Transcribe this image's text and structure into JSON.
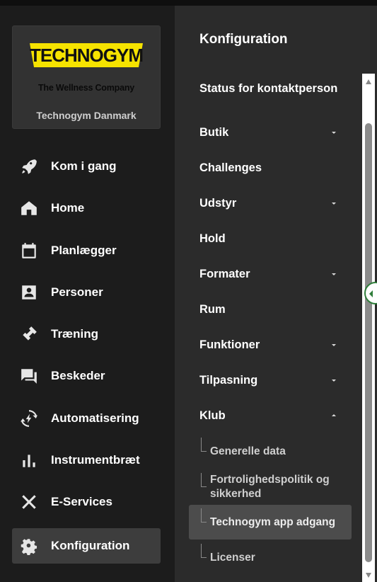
{
  "brand": {
    "logo_text": "TECHNOGYM",
    "tagline": "The Wellness Company",
    "club_name": "Technogym Danmark",
    "logo_color": "#f6e300"
  },
  "nav": [
    {
      "label": "Kom i gang",
      "icon": "rocket-icon"
    },
    {
      "label": "Home",
      "icon": "home-icon"
    },
    {
      "label": "Planlægger",
      "icon": "calendar-icon"
    },
    {
      "label": "Personer",
      "icon": "person-card-icon"
    },
    {
      "label": "Træning",
      "icon": "dumbbell-icon"
    },
    {
      "label": "Beskeder",
      "icon": "chat-icon"
    },
    {
      "label": "Automatisering",
      "icon": "automation-icon"
    },
    {
      "label": "Instrumentbræt",
      "icon": "bar-chart-icon"
    },
    {
      "label": "E-Services",
      "icon": "tools-icon"
    },
    {
      "label": "Konfiguration",
      "icon": "gear-icon",
      "active": true
    }
  ],
  "config": {
    "title": "Konfiguration",
    "items": [
      {
        "label": "Status for kontaktperson"
      },
      {
        "label": "Butik",
        "expandable": true
      },
      {
        "label": "Challenges"
      },
      {
        "label": "Udstyr",
        "expandable": true
      },
      {
        "label": "Hold"
      },
      {
        "label": "Formater",
        "expandable": true
      },
      {
        "label": "Rum"
      },
      {
        "label": "Funktioner",
        "expandable": true
      },
      {
        "label": "Tilpasning",
        "expandable": true
      },
      {
        "label": "Klub",
        "expandable": true,
        "expanded": true
      }
    ],
    "klub_subitems": [
      {
        "label": "Generelle data"
      },
      {
        "label": "Fortrolighedspolitik og sikkerhed"
      },
      {
        "label": "Technogym app adgang",
        "active": true
      },
      {
        "label": "Licenser"
      }
    ]
  },
  "colors": {
    "sidebar_bg": "#1c1c1c",
    "panel_bg": "#2b2b2b",
    "active_bg": "#3d3d3d",
    "accent_green": "#2f7d3a"
  }
}
